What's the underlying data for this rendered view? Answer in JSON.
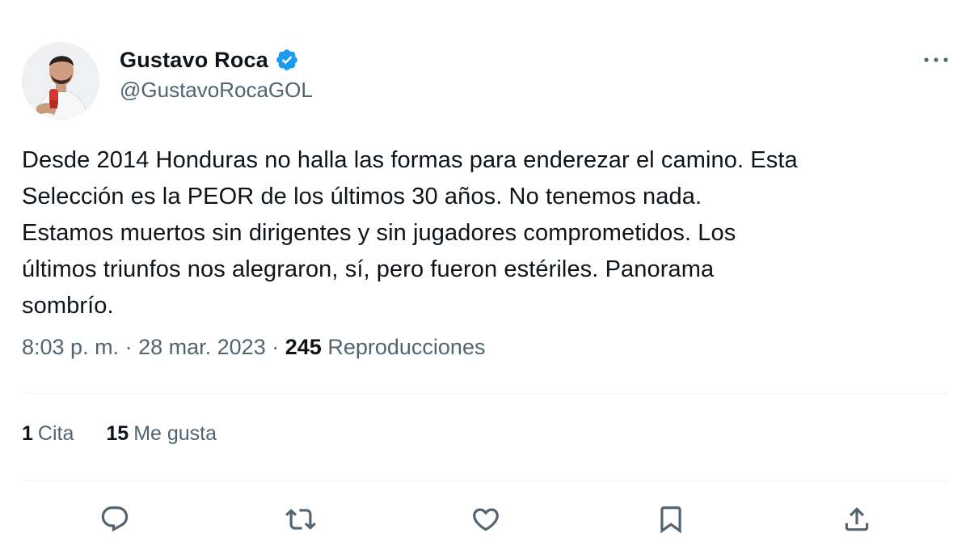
{
  "author": {
    "display_name": "Gustavo Roca",
    "handle": "@GustavoRocaGOL",
    "verified_icon": "verified-badge-icon",
    "verified_color": "#1d9bf0"
  },
  "tweet": {
    "text": "Desde 2014 Honduras no halla las formas para enderezar el camino. Esta\nSelección es la PEOR de los últimos 30 años. No tenemos nada.\nEstamos muertos sin dirigentes y sin jugadores comprometidos. Los\núltimos triunfos nos alegraron, sí, pero fueron estériles. Panorama\nsombrío.",
    "time": "8:03 p. m.",
    "separator": "·",
    "date": "28 mar. 2023",
    "views_count": "245",
    "views_label": "Reproducciones"
  },
  "stats": {
    "quotes_count": "1",
    "quotes_label": "Cita",
    "likes_count": "15",
    "likes_label": "Me gusta"
  },
  "actions": [
    "reply-icon",
    "retweet-icon",
    "like-icon",
    "bookmark-icon",
    "share-icon"
  ],
  "colors": {
    "text": "#0f1419",
    "secondary": "#536471",
    "divider": "#eff3f4",
    "accent": "#1d9bf0"
  }
}
